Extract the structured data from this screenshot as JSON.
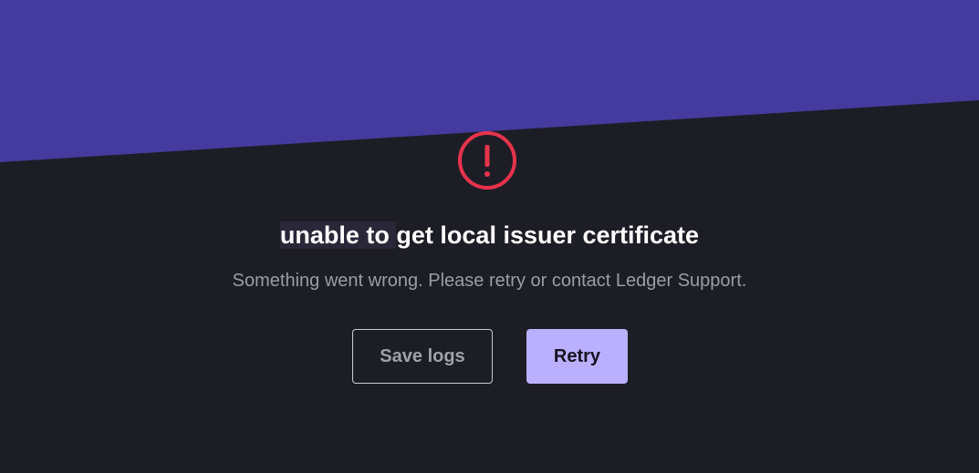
{
  "colors": {
    "background": "#1d1d25",
    "header_band": "#453a9d",
    "error_icon": "#e8334c",
    "primary_button": "#bbb0ff",
    "title_text": "#ffffff",
    "subtitle_text": "#9c9ca6"
  },
  "error": {
    "icon": "exclamation-circle-icon",
    "title_highlighted": "unable to ",
    "title_rest": "get local issuer certificate",
    "message": "Something went wrong. Please retry or contact Ledger Support."
  },
  "actions": {
    "save_logs_label": "Save logs",
    "retry_label": "Retry"
  }
}
